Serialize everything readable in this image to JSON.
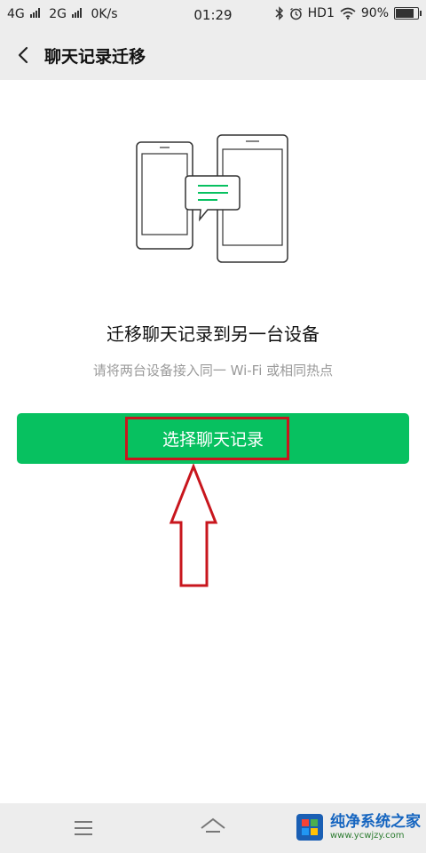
{
  "status_bar": {
    "net1": "4G",
    "net2": "2G",
    "speed": "0K/s",
    "time": "01:29",
    "hd": "HD1",
    "battery": "90%",
    "battery_level": 0.9
  },
  "nav": {
    "title": "聊天记录迁移"
  },
  "content": {
    "title": "迁移聊天记录到另一台设备",
    "subtitle": "请将两台设备接入同一 Wi-Fi 或相同热点",
    "button_label": "选择聊天记录"
  },
  "colors": {
    "accent": "#07c160",
    "highlight": "#c8161d",
    "bar_bg": "#ededed"
  },
  "watermark": {
    "title": "纯净系统之家",
    "url": "www.ycwjzy.com"
  }
}
